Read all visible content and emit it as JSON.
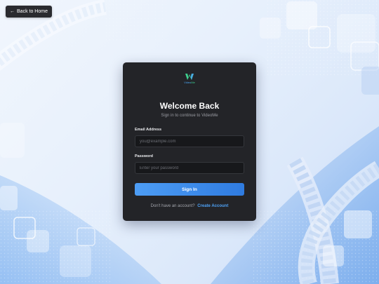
{
  "nav": {
    "back_label": "Back to Home"
  },
  "brand": {
    "logo_text_a": "Video",
    "logo_text_b": "Me"
  },
  "login": {
    "title": "Welcome Back",
    "subtitle": "Sign in to continue to VideoMe",
    "email_label": "Email Address",
    "email_placeholder": "you@example.com",
    "email_value": "",
    "password_label": "Password",
    "password_placeholder": "Enter your password",
    "password_value": "",
    "submit_label": "Sign In",
    "footer_prompt": "Don't have an account?",
    "footer_link": "Create Account"
  },
  "colors": {
    "accent": "#3b8df0",
    "card_bg": "#232428",
    "link": "#4ea1f5"
  },
  "icons": {
    "back": "arrow-left-icon",
    "logo": "videome-logo-icon"
  }
}
